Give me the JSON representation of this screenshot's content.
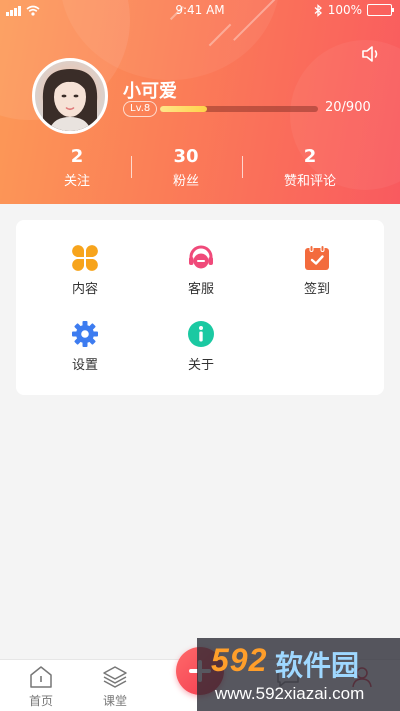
{
  "status_bar": {
    "time": "9:41 AM",
    "battery": "100%"
  },
  "profile": {
    "username": "小可爱",
    "level": "Lv.8",
    "exp_text": "20/900",
    "exp_progress": 0.3
  },
  "stats": [
    {
      "value": "2",
      "label": "关注"
    },
    {
      "value": "30",
      "label": "粉丝"
    },
    {
      "value": "2",
      "label": "赞和评论"
    }
  ],
  "menu": {
    "content": {
      "label": "内容",
      "icon": "grid-icon",
      "color": "#f7a41c"
    },
    "service": {
      "label": "客服",
      "icon": "headset-icon",
      "color": "#f04a7a"
    },
    "checkin": {
      "label": "签到",
      "icon": "calendar-icon",
      "color": "#f36b3d"
    },
    "settings": {
      "label": "设置",
      "icon": "gear-icon",
      "color": "#3d7cf0"
    },
    "about": {
      "label": "关于",
      "icon": "info-icon",
      "color": "#1bc9a2"
    }
  },
  "tabbar": {
    "home": {
      "label": "首页",
      "icon": "home-icon"
    },
    "classroom": {
      "label": "课堂",
      "icon": "layers-icon"
    },
    "add": {
      "icon": "plus-icon"
    }
  },
  "watermark": {
    "logo": "592",
    "name": "软件园",
    "url": "www.592xiazai.com"
  }
}
